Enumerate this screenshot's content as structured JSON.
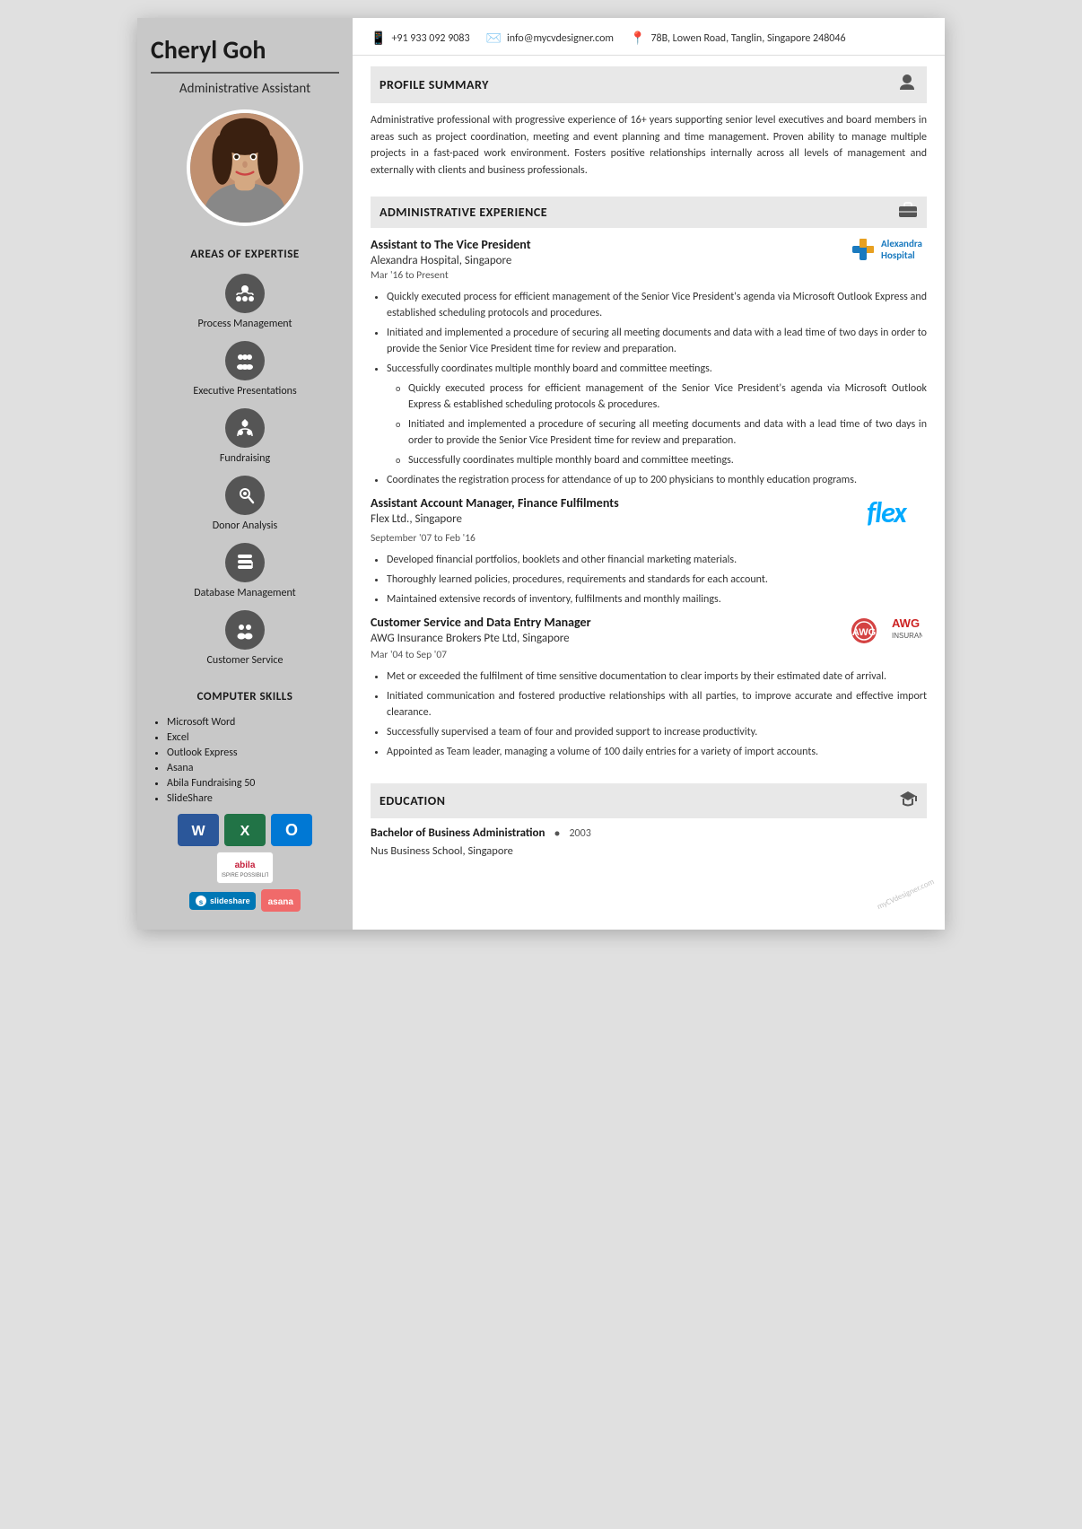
{
  "person": {
    "name": "Cheryl Goh",
    "title": "Administrative Assistant"
  },
  "contact": {
    "phone": "+91 933 092 9083",
    "email": "info@mycvdesigner.com",
    "address": "78B, Lowen Road, Tanglin, Singapore 248046"
  },
  "profile_summary": {
    "heading": "PROFILE SUMMARY",
    "text": "Administrative professional with progressive experience of 16+ years supporting senior level executives and board members in areas such as project coordination, meeting and event planning and time management. Proven ability to manage multiple projects in a fast-paced work environment. Fosters positive relationships internally across all levels of management and externally with clients and business professionals."
  },
  "expertise": {
    "heading": "AREAS OF EXPERTISE",
    "items": [
      {
        "label": "Process Management"
      },
      {
        "label": "Executive Presentations"
      },
      {
        "label": "Fundraising"
      },
      {
        "label": "Donor Analysis"
      },
      {
        "label": "Database Management"
      },
      {
        "label": "Customer Service"
      }
    ]
  },
  "computer_skills": {
    "heading": "COMPUTER SKILLS",
    "items": [
      "Microsoft Word",
      "Excel",
      "Outlook Express",
      "Asana",
      "Abila Fundraising 50",
      "SlideShare"
    ]
  },
  "admin_experience": {
    "heading": "ADMINISTRATIVE EXPERIENCE",
    "jobs": [
      {
        "title": "Assistant to The Vice President",
        "company": "Alexandra Hospital, Singapore",
        "dates": "Mar '16 to Present",
        "logo": "alexandra",
        "bullets": [
          "Quickly executed process for efficient management of the Senior Vice President's agenda via Microsoft Outlook Express and established scheduling protocols and procedures.",
          "Initiated and implemented a procedure of securing all meeting documents and data with a lead time of two days in order to provide the Senior Vice President time for review and preparation.",
          "Successfully coordinates multiple monthly board and committee meetings.",
          "Coordinates the registration process for attendance of up to 200 physicians to monthly education programs."
        ],
        "sub_bullets": [
          "Quickly executed process for efficient management of the Senior Vice President's agenda via Microsoft Outlook Express & established scheduling protocols & procedures.",
          "Initiated and implemented a procedure of securing all meeting documents and data with a lead time of two days in order to provide the Senior Vice President time for review and preparation.",
          "Successfully coordinates multiple monthly board and committee meetings."
        ],
        "third_bullet_has_sub": true
      },
      {
        "title": "Assistant Account Manager, Finance Fulfilments",
        "company": "Flex Ltd., Singapore",
        "dates": "September '07 to Feb '16",
        "logo": "flex",
        "bullets": [
          "Developed financial portfolios, booklets and other financial marketing materials.",
          "Thoroughly learned policies, procedures, requirements and standards for each account.",
          "Maintained extensive records of inventory, fulfilments and monthly mailings."
        ]
      },
      {
        "title": "Customer Service and Data Entry Manager",
        "company": "AWG Insurance Brokers Pte Ltd, Singapore",
        "dates": "Mar '04 to Sep '07",
        "logo": "awg",
        "bullets": [
          "Met or exceeded the fulfilment of time sensitive documentation to clear imports by their estimated date of arrival.",
          "Initiated communication and fostered productive relationships with all parties, to improve accurate and effective import clearance.",
          "Successfully supervised a team of four and provided support to increase productivity.",
          "Appointed as Team leader, managing a volume of 100 daily entries for a variety of import accounts."
        ]
      }
    ]
  },
  "education": {
    "heading": "EDUCATION",
    "items": [
      {
        "degree": "Bachelor of Business Administration",
        "year": "2003",
        "school": "Nus Business School, Singapore"
      }
    ]
  }
}
